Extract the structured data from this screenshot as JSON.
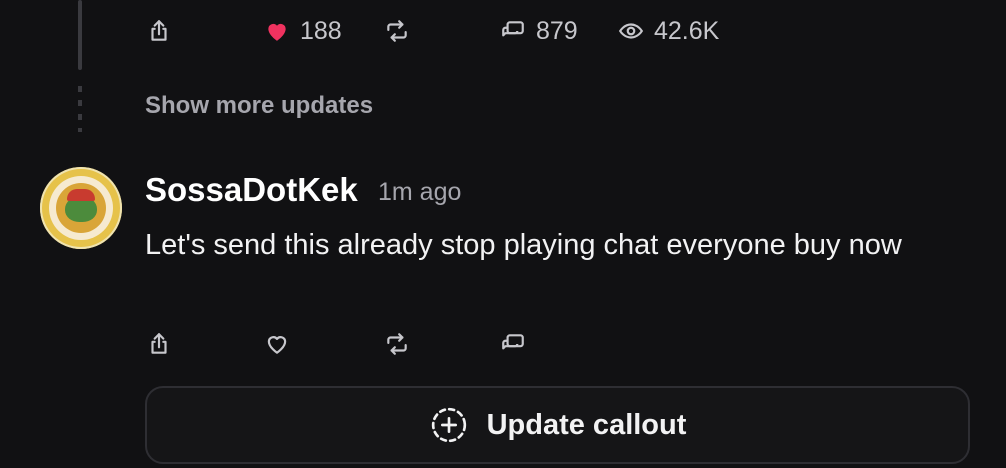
{
  "colors": {
    "background": "#111113",
    "heart_active": "#f0325f",
    "muted_text": "#a6a6ad",
    "icon": "#c7c7cc"
  },
  "top_post": {
    "actions": {
      "share_icon": "share-icon",
      "like_icon": "heart-filled-icon",
      "like_count": "188",
      "repost_icon": "repost-icon",
      "comment_icon": "comment-icon",
      "comment_count": "879",
      "views_icon": "eye-icon",
      "views_count": "42.6K"
    }
  },
  "show_more": {
    "label": "Show more updates"
  },
  "post": {
    "username": "SossaDotKek",
    "timestamp": "1m ago",
    "message": "Let's send this already stop playing chat everyone buy now",
    "actions": {
      "share_icon": "share-icon",
      "like_icon": "heart-outline-icon",
      "repost_icon": "repost-icon",
      "comment_icon": "comment-icon"
    }
  },
  "callout_button": {
    "icon": "plus-circle-dashed-icon",
    "label": "Update callout"
  }
}
